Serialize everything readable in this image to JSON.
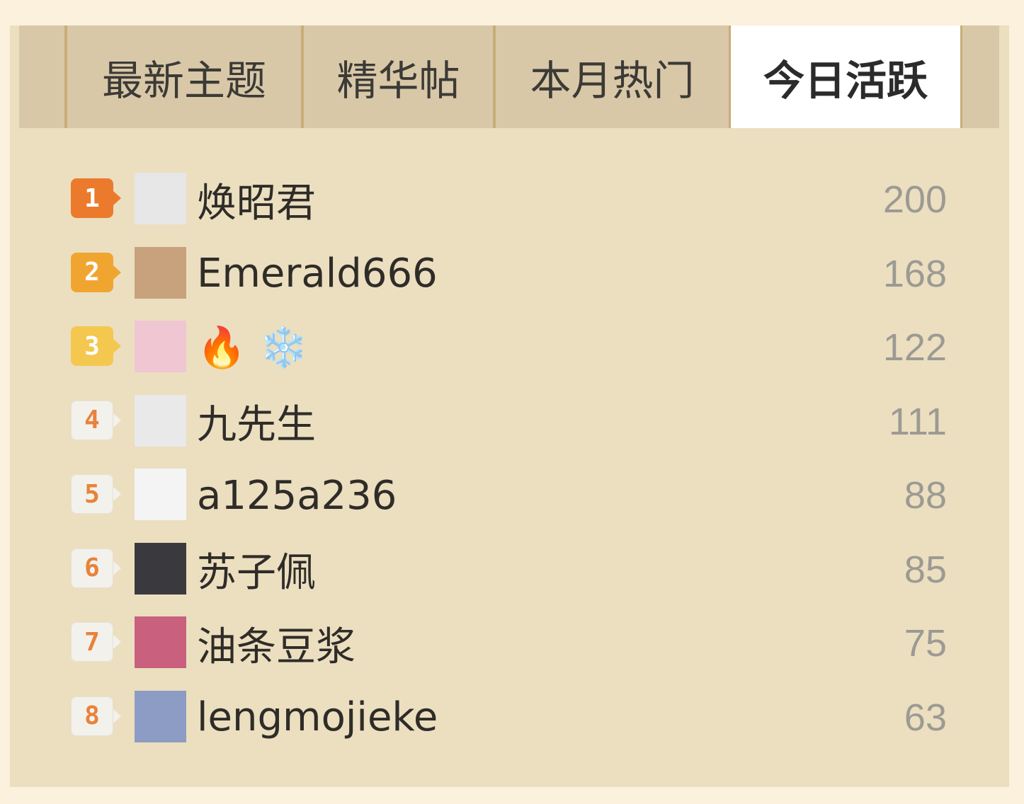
{
  "tabs": [
    {
      "label": "最新主题",
      "active": false
    },
    {
      "label": "精华帖",
      "active": false
    },
    {
      "label": "本月热门",
      "active": false
    },
    {
      "label": "今日活跃",
      "active": true
    }
  ],
  "ranking": [
    {
      "rank": "1",
      "name": "焕昭君",
      "score": "200",
      "badge_bg": "#ec7a2c",
      "badge_fg": "#ffffff",
      "avatar_bg": "#e7e7e7",
      "avatar_fg": "#555555"
    },
    {
      "rank": "2",
      "name": "Emerald666",
      "score": "168",
      "badge_bg": "#f1a531",
      "badge_fg": "#ffffff",
      "avatar_bg": "#c8a17d",
      "avatar_fg": "#ffffff"
    },
    {
      "rank": "3",
      "name": "🔥 ❄️",
      "score": "122",
      "badge_bg": "#f4c74f",
      "badge_fg": "#ffffff",
      "avatar_bg": "#f0c6d3",
      "avatar_fg": "#b0506b"
    },
    {
      "rank": "4",
      "name": "九先生",
      "score": "111",
      "badge_bg": "#f3f1ec",
      "badge_fg": "#e8823b",
      "avatar_bg": "#e9e9e9",
      "avatar_fg": "#222222"
    },
    {
      "rank": "5",
      "name": "a125a236",
      "score": "88",
      "badge_bg": "#f3f1ec",
      "badge_fg": "#e8823b",
      "avatar_bg": "#f4f4f4",
      "avatar_fg": "#444444"
    },
    {
      "rank": "6",
      "name": "苏子佩",
      "score": "85",
      "badge_bg": "#f3f1ec",
      "badge_fg": "#e8823b",
      "avatar_bg": "#3a3a3e",
      "avatar_fg": "#dddddd"
    },
    {
      "rank": "7",
      "name": "油条豆浆",
      "score": "75",
      "badge_bg": "#f3f1ec",
      "badge_fg": "#e8823b",
      "avatar_bg": "#c9607d",
      "avatar_fg": "#ffffff"
    },
    {
      "rank": "8",
      "name": "lengmojieke",
      "score": "63",
      "badge_bg": "#f3f1ec",
      "badge_fg": "#e8823b",
      "avatar_bg": "#8d9cc4",
      "avatar_fg": "#ffffff"
    }
  ],
  "colors": {
    "page_bg": "#fbf1dc",
    "panel_bg": "#ebdfc0",
    "tabbar_bg": "#d8c8a8",
    "tab_divider": "#c9ad7a",
    "score_text": "#9d9a94"
  }
}
